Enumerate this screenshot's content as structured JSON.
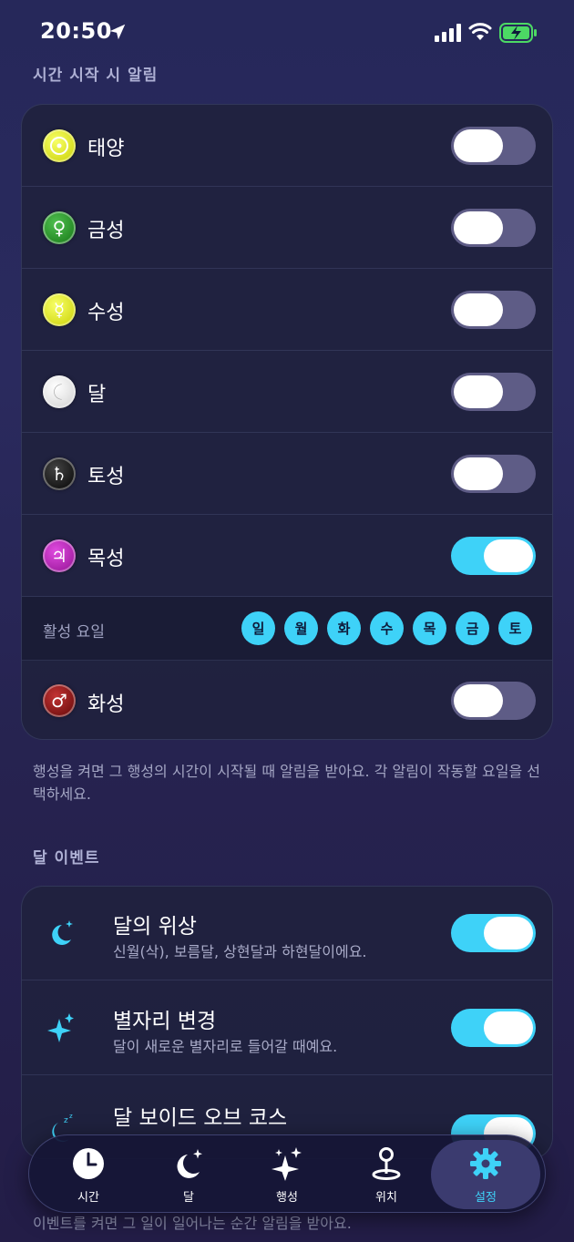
{
  "status": {
    "time": "20:50"
  },
  "planet_section": {
    "header": "시간 시작 시 알림",
    "planets": [
      {
        "name": "태양",
        "icon": "sun-icon",
        "on": false,
        "color": "#d9e000"
      },
      {
        "name": "금성",
        "icon": "venus-icon",
        "on": false,
        "color": "#1f8a1f"
      },
      {
        "name": "수성",
        "icon": "mercury-icon",
        "on": false,
        "color": "#d9e000"
      },
      {
        "name": "달",
        "icon": "moon-icon",
        "on": false,
        "color": "#e6e6e6"
      },
      {
        "name": "토성",
        "icon": "saturn-icon",
        "on": false,
        "color": "#111111"
      },
      {
        "name": "목성",
        "icon": "jupiter-icon",
        "on": true,
        "color": "#b21ab2"
      },
      {
        "name": "화성",
        "icon": "mars-icon",
        "on": false,
        "color": "#8a0f0f"
      }
    ],
    "active_days_label": "활성 요일",
    "days": [
      "일",
      "월",
      "화",
      "수",
      "목",
      "금",
      "토"
    ],
    "footnote": "행성을 켜면 그 행성의 시간이 시작될 때 알림을 받아요. 각 알림이 작동할 요일을 선택하세요."
  },
  "moon_section": {
    "header": "달 이벤트",
    "events": [
      {
        "title": "달의 위상",
        "subtitle": "신월(삭), 보름달, 상현달과 하현달이에요.",
        "on": true,
        "icon": "moon-stars-icon"
      },
      {
        "title": "별자리 변경",
        "subtitle": "달이 새로운 별자리로 들어갈 때예요.",
        "on": true,
        "icon": "sparkles-icon"
      },
      {
        "title": "달 보이드 오브 코스",
        "subtitle": "",
        "on": true,
        "icon": "moon-zzz-icon"
      }
    ],
    "footnote": "이벤트를 켜면 그 일이 일어나는 순간 알림을 받아요."
  },
  "tabbar": {
    "tabs": [
      {
        "label": "시간",
        "icon": "clock-icon"
      },
      {
        "label": "달",
        "icon": "moon-stars-icon"
      },
      {
        "label": "행성",
        "icon": "sparkles-icon"
      },
      {
        "label": "위치",
        "icon": "location-pin-icon"
      },
      {
        "label": "설정",
        "icon": "gear-icon",
        "active": true
      }
    ]
  },
  "colors": {
    "accent": "#3ed2f8",
    "toggle_off": "#5e5c86"
  }
}
